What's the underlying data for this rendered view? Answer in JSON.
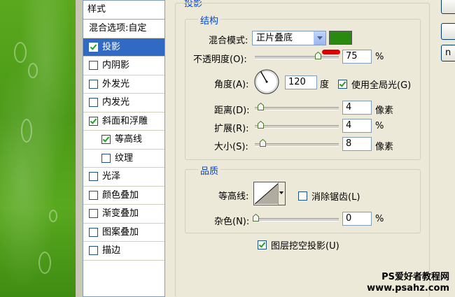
{
  "styles_panel": {
    "header": "样式",
    "blend_options": "混合选项:自定",
    "items": [
      {
        "label": "投影",
        "checked": true,
        "selected": true,
        "sub": false
      },
      {
        "label": "内阴影",
        "checked": false,
        "selected": false,
        "sub": false
      },
      {
        "label": "外发光",
        "checked": false,
        "selected": false,
        "sub": false
      },
      {
        "label": "内发光",
        "checked": false,
        "selected": false,
        "sub": false
      },
      {
        "label": "斜面和浮雕",
        "checked": true,
        "selected": false,
        "sub": false
      },
      {
        "label": "等高线",
        "checked": true,
        "selected": false,
        "sub": true
      },
      {
        "label": "纹理",
        "checked": false,
        "selected": false,
        "sub": true
      },
      {
        "label": "光泽",
        "checked": false,
        "selected": false,
        "sub": false
      },
      {
        "label": "颜色叠加",
        "checked": false,
        "selected": false,
        "sub": false
      },
      {
        "label": "渐变叠加",
        "checked": false,
        "selected": false,
        "sub": false
      },
      {
        "label": "图案叠加",
        "checked": false,
        "selected": false,
        "sub": false
      },
      {
        "label": "描边",
        "checked": false,
        "selected": false,
        "sub": false
      }
    ]
  },
  "drop_shadow": {
    "title": "投影",
    "structure": {
      "legend": "结构",
      "blend_mode_label": "混合模式:",
      "blend_mode_value": "正片叠底",
      "shadow_color": "#2a8a10",
      "opacity_label": "不透明度(O):",
      "opacity_value": "75",
      "opacity_unit": "%",
      "opacity_level": 0.75,
      "angle_label": "角度(A):",
      "angle_value": "120",
      "angle_unit": "度",
      "global_light_label": "使用全局光(G)",
      "global_light_checked": true,
      "distance_label": "距离(D):",
      "distance_value": "4",
      "distance_unit": "像素",
      "spread_label": "扩展(R):",
      "spread_value": "4",
      "spread_unit": "%",
      "size_label": "大小(S):",
      "size_value": "8",
      "size_unit": "像素"
    },
    "quality": {
      "legend": "品质",
      "contour_label": "等高线:",
      "antialias_label": "消除锯齿(L)",
      "antialias_checked": false,
      "noise_label": "杂色(N):",
      "noise_value": "0",
      "noise_unit": "%"
    },
    "knockout_label": "图层挖空投影(U)",
    "knockout_checked": true
  },
  "watermark": {
    "line1": "PS爱好者教程网",
    "line2": "www.psahz.com"
  },
  "colors": {
    "selection": "#316ac5",
    "legend_text": "#0046d5",
    "marker": "#e00000"
  }
}
